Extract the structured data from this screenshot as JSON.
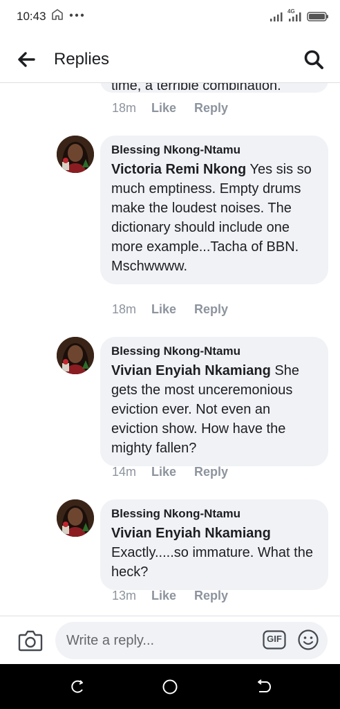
{
  "status_bar": {
    "time": "10:43",
    "network_label": "4G",
    "icons": [
      "app-notification-icon",
      "more-dots-icon",
      "signal-icon",
      "signal-4g-icon",
      "battery-icon"
    ]
  },
  "header": {
    "title": "Replies",
    "back_icon": "arrow-left-icon",
    "search_icon": "search-icon"
  },
  "partial_comment": {
    "text_tail": "time, a terrible combination.",
    "time": "18m",
    "like_label": "Like",
    "reply_label": "Reply"
  },
  "comments": [
    {
      "author": "Blessing Nkong-Ntamu",
      "mention": "Victoria Remi Nkong",
      "text": "Yes sis so much emptiness. Empty drums make the loudest noises. The dictionary should include one more example...Tacha of BBN. Mschwwww.",
      "time": "18m",
      "like_label": "Like",
      "reply_label": "Reply"
    },
    {
      "author": "Blessing Nkong-Ntamu",
      "mention": "Vivian Enyiah Nkamiang",
      "text": "She gets the most unceremonious eviction ever. Not even an eviction show. How have the mighty fallen?",
      "time": "14m",
      "like_label": "Like",
      "reply_label": "Reply"
    },
    {
      "author": "Blessing Nkong-Ntamu",
      "mention": "Vivian Enyiah Nkamiang",
      "text": "Exactly.....so immature. What the heck?",
      "time": "13m",
      "like_label": "Like",
      "reply_label": "Reply"
    }
  ],
  "composer": {
    "placeholder": "Write a reply...",
    "gif_label": "GIF",
    "camera_icon": "camera-icon",
    "emoji_icon": "emoji-icon"
  },
  "nav": {
    "icons": [
      "recent-apps-icon",
      "home-icon",
      "back-icon"
    ]
  },
  "colors": {
    "bubble": "#f0f2f5",
    "meta_text": "#8d949e",
    "text": "#1c1e21",
    "nav_bar": "#000000"
  }
}
